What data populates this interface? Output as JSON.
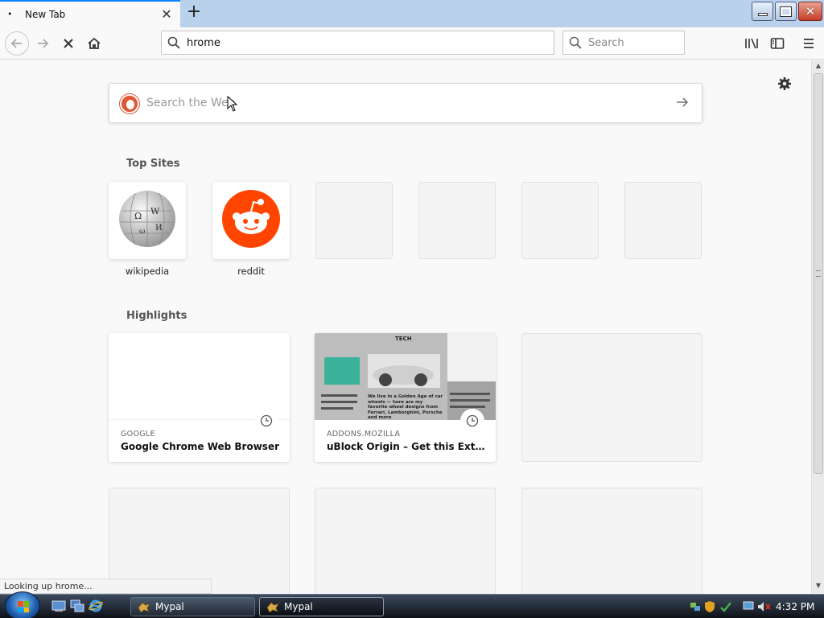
{
  "tab": {
    "title": "New Tab"
  },
  "navbar": {
    "url": "hrome",
    "search_placeholder": "Search"
  },
  "websearch": {
    "placeholder": "Search the Web"
  },
  "top_sites": {
    "heading": "Top Sites",
    "items": [
      {
        "label": "wikipedia"
      },
      {
        "label": "reddit"
      }
    ]
  },
  "highlights": {
    "heading": "Highlights",
    "items": [
      {
        "source": "GOOGLE",
        "title": "Google Chrome Web Browser"
      },
      {
        "source": "ADDONS.MOZILLA",
        "title": "uBlock Origin – Get this Extensio..."
      }
    ],
    "thumb_text": {
      "tag": "TECH",
      "headline": "We live in a Golden Age of car wheels — here are my favorite wheel designs from Ferrari, Lamborghini, Porsche and more"
    }
  },
  "status_text": "Looking up hrome...",
  "taskbar": {
    "buttons": [
      {
        "label": "Mypal"
      },
      {
        "label": "Mypal"
      }
    ],
    "clock": "4:32 PM"
  },
  "colors": {
    "accent": "#0a84ff",
    "reddit": "#ff4500",
    "ddg": "#de5833"
  },
  "icons": [
    "search-icon",
    "gear-icon",
    "arrow-right-icon",
    "clock-icon",
    "library-icon",
    "sidebar-icon",
    "menu-icon",
    "home-icon",
    "stop-icon"
  ]
}
